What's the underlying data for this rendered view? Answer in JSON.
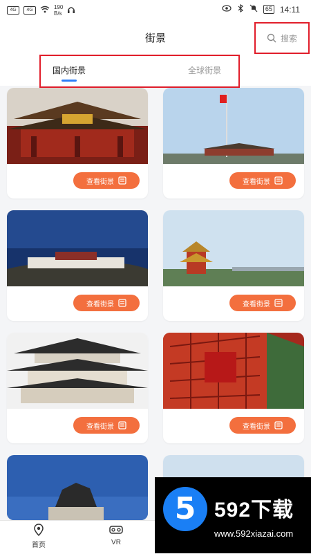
{
  "status_bar": {
    "signal_left": "4G",
    "signal_right": "4G",
    "speed": "190",
    "speed_unit": "B/s",
    "battery": "65",
    "time": "14:11"
  },
  "header": {
    "title": "街景",
    "search_label": "搜索"
  },
  "tabs": [
    {
      "label": "国内街景"
    },
    {
      "label": "全球街景"
    }
  ],
  "cards": [
    {
      "button_label": "查看街景"
    },
    {
      "button_label": "查看街景"
    },
    {
      "button_label": "查看街景"
    },
    {
      "button_label": "查看街景"
    },
    {
      "button_label": "查看街景"
    },
    {
      "button_label": "查看街景"
    },
    {
      "button_label": ""
    },
    {
      "button_label": ""
    }
  ],
  "bottom_nav": [
    {
      "label": "首页"
    },
    {
      "label": "VR"
    }
  ],
  "overlay": {
    "number": "5",
    "brand": "592下载",
    "url": "www.592xiazai.com"
  },
  "colors": {
    "accent": "#f36f3e",
    "highlight_box": "#e11d2a",
    "tab_underline": "#2d7ff9"
  }
}
